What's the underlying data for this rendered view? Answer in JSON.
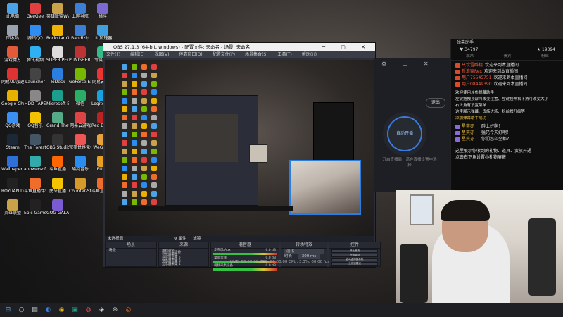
{
  "desktop": {
    "icons": [
      {
        "label": "此电脑",
        "color": "#4aa3e8"
      },
      {
        "label": "GeeGee",
        "color": "#e04040"
      },
      {
        "label": "英雄联盟WeGame版",
        "color": "#c9a24a"
      },
      {
        "label": "上网导航",
        "color": "#3c7fd8"
      },
      {
        "label": "格斗",
        "color": "#7b6bd1"
      },
      {
        "label": "回收站",
        "color": "#9aa3ad"
      },
      {
        "label": "腾讯QQ",
        "color": "#2f8cf0"
      },
      {
        "label": "Rockstar Games",
        "color": "#f2b400"
      },
      {
        "label": "Bandizip",
        "color": "#3c7ed6"
      },
      {
        "label": "UU加速器",
        "color": "#3fa0e0"
      },
      {
        "label": "游戏魔方",
        "color": "#e25a3a"
      },
      {
        "label": "腾讯视频",
        "color": "#2fb1f1"
      },
      {
        "label": "SUPER PEOPLE CBT",
        "color": "#ddd"
      },
      {
        "label": "PUNISHER Ports",
        "color": "#b33"
      },
      {
        "label": "专属加速",
        "color": "#3b8"
      },
      {
        "label": "网易UU加速",
        "color": "#d33"
      },
      {
        "label": "Launcher",
        "color": "#444"
      },
      {
        "label": "ToDesk",
        "color": "#2b7fe0"
      },
      {
        "label": "GeForce Experience",
        "color": "#76b900"
      },
      {
        "label": "网易云音乐",
        "color": "#e33"
      },
      {
        "label": "Google Chrome",
        "color": "#e8b000"
      },
      {
        "label": "HDD TAPE",
        "color": "#888"
      },
      {
        "label": "Microsoft Edge",
        "color": "#1d9e8d"
      },
      {
        "label": "微信",
        "color": "#2aae67"
      },
      {
        "label": "Logitech G HUB",
        "color": "#16a3e0"
      },
      {
        "label": "QQ游戏",
        "color": "#3a8ff0"
      },
      {
        "label": "QQ音乐",
        "color": "#f3c300"
      },
      {
        "label": "Grand Theft Auto V",
        "color": "#5a8"
      },
      {
        "label": "网易云游戏",
        "color": "#d44"
      },
      {
        "label": "Red Dead Redemption",
        "color": "#b22"
      },
      {
        "label": "Steam",
        "color": "#1b2838"
      },
      {
        "label": "The Forest",
        "color": "#456"
      },
      {
        "label": "OBS Studio",
        "color": "#333"
      },
      {
        "label": "完美世界竞技",
        "color": "#e55"
      },
      {
        "label": "WeGame",
        "color": "#e8a23a"
      },
      {
        "label": "Wallpaper Engine",
        "color": "#2f6fd8"
      },
      {
        "label": "apowersoft",
        "color": "#3aa"
      },
      {
        "label": "斗鱼直播",
        "color": "#f60"
      },
      {
        "label": "酷狗音乐",
        "color": "#2a8ef0"
      },
      {
        "label": "PUBG",
        "color": "#e9a020"
      },
      {
        "label": "ROYUAN Driver",
        "color": "#222"
      },
      {
        "label": "斗鱼直播伴侣",
        "color": "#f06c2a"
      },
      {
        "label": "虎牙直播",
        "color": "#f5c400"
      },
      {
        "label": "Counter-Strike Global Off...",
        "color": "#d49a2a"
      },
      {
        "label": "斗鱼直播伴侣",
        "color": "#f06c2a"
      },
      {
        "label": "英雄联盟",
        "color": "#c9a24a"
      },
      {
        "label": "Epic Games Launcher",
        "color": "#222"
      },
      {
        "label": "GOG GALAXY",
        "color": "#7b5bd1"
      }
    ]
  },
  "obs": {
    "title": "OBS 27.1.3 (64-bit, windows) - 配置文件: 未命名 - 场景: 未命名",
    "window_controls": "─ ▢ ✕",
    "menu": [
      "文件(F)",
      "编辑(E)",
      "视图(V)",
      "停靠窗口(D)",
      "配置文件(P)",
      "场景集合(S)",
      "工具(T)",
      "帮助(H)"
    ],
    "no_source": "未选择源",
    "properties": "⚙ 属性",
    "filters": "滤镜",
    "docks": {
      "scenes": {
        "title": "场景",
        "items": [
          "场景"
        ]
      },
      "sources": {
        "title": "来源",
        "items": [
          "窗口捕获",
          "视频采集设备",
          "显示器采集",
          "显示器采集 2",
          "显示器采集 3",
          "显示器采集 4"
        ]
      },
      "mixer": {
        "title": "混音器",
        "tracks": [
          {
            "name": "麦克风/Aux",
            "db": "0.0 dB"
          },
          {
            "name": "桌面音频",
            "db": "0.0 dB"
          },
          {
            "name": "视频采集设备",
            "db": "0.0 dB"
          }
        ]
      },
      "transitions": {
        "title": "转场特效",
        "type": "淡化",
        "duration_label": "时长",
        "duration": "300 ms"
      },
      "controls": {
        "title": "控件",
        "buttons": [
          "停止推流",
          "开始录制",
          "启动虚拟摄像机",
          "工作室模式",
          "设置",
          "退出"
        ]
      }
    },
    "status": "LIVE: 00:00:00   REC: 00:00:00   CPU: 3.3%, 60.00 fps"
  },
  "app2": {
    "icons": "⚙ ▭ ✕",
    "out_btn": "退出",
    "live_btn": "自动开播",
    "desc": "开启直播后，请在直播设置中选择"
  },
  "chat": {
    "title": "弹幕助手",
    "stats": {
      "left": "♥ 34797",
      "right": "★ 19394"
    },
    "tabs": [
      "观众",
      "贵宾",
      "粉丝"
    ],
    "messages": [
      {
        "user": "只欢雪醉精",
        "text": "欢迎来到本直播间",
        "blue": false
      },
      {
        "user": "新浪家Rex",
        "text": "欢迎来到本直播间",
        "blue": false
      },
      {
        "user": "用户75545751",
        "text": "欢迎来到本直播间",
        "blue": false
      },
      {
        "user": "用户08449390",
        "text": "欢迎来到本直播间",
        "blue": false
      }
    ],
    "system": [
      "欢迎使用斗鱼弹幕助手",
      "左键拖拽顶部可改变位置、左键拉伸右下角可改变大小",
      "右上角有设置菜单",
      "这里展示弹幕、贵族进场、粉丝牌升级等",
      "添加弹幕助手成功"
    ],
    "gifts": [
      {
        "user": "星爽亦",
        "text": "醉上好啊！"
      },
      {
        "user": "星爽亦",
        "text": "猛兄今天好啊！"
      },
      {
        "user": "星爽亦",
        "text": "你们怎么全都?"
      }
    ],
    "footer": [
      "这里展示你收到的礼物、道具、贵族开通",
      "点击右下角设置小礼物屏蔽"
    ]
  },
  "taskbar": {
    "items": [
      "⊞",
      "○",
      "▤",
      "◐",
      "◉",
      "▣",
      "◍",
      "◈",
      "⊚",
      "◎"
    ],
    "colors": [
      "#4aa3e8",
      "#ccc",
      "#ccc",
      "#3c7fd8",
      "#e8b000",
      "#1d9e8d",
      "#e55",
      "#ccc",
      "#ccc",
      "#f06c2a"
    ]
  }
}
